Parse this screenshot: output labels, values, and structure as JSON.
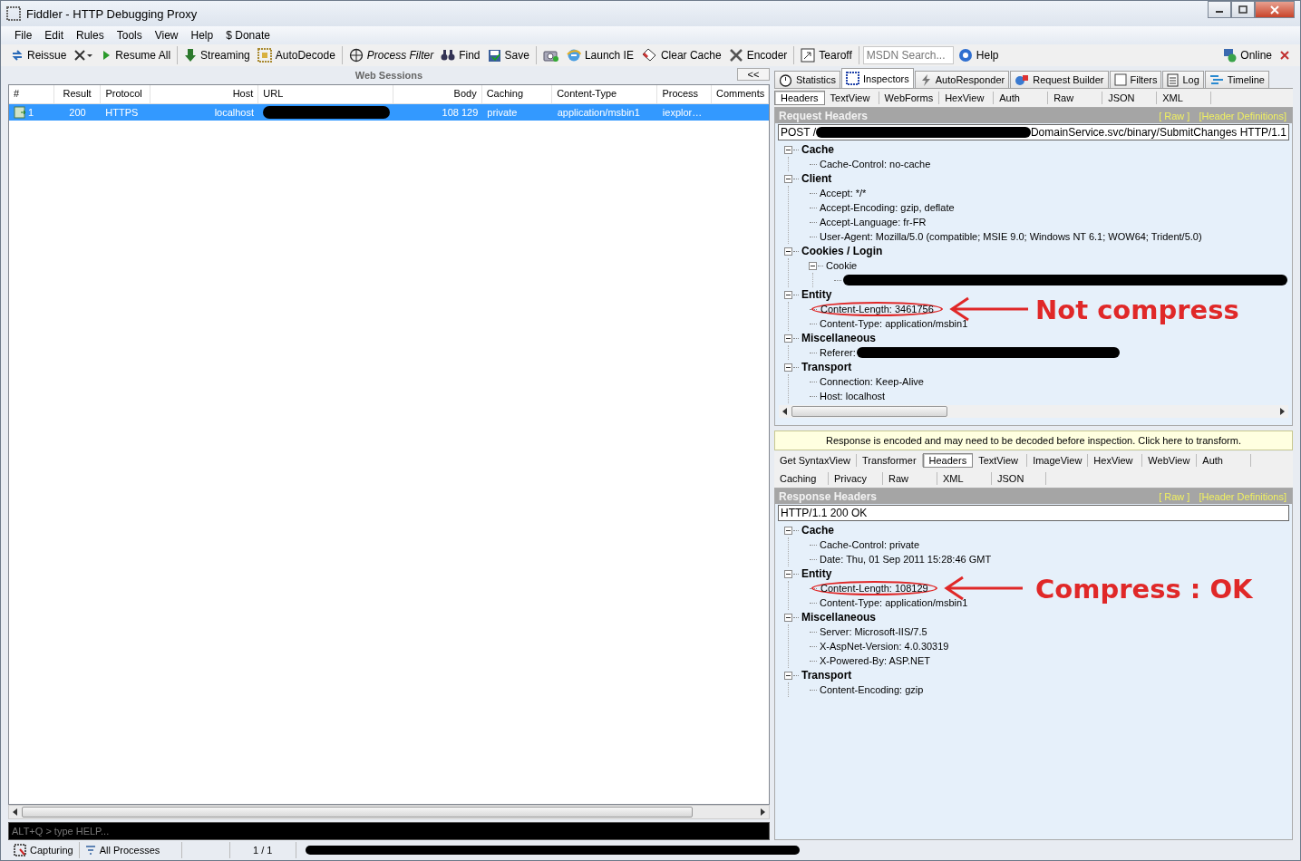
{
  "window": {
    "title": "Fiddler - HTTP Debugging Proxy"
  },
  "menu": [
    "File",
    "Edit",
    "Rules",
    "Tools",
    "View",
    "Help",
    "$ Donate"
  ],
  "toolbar": [
    {
      "kind": "reissue",
      "label": "Reissue"
    },
    {
      "kind": "remove"
    },
    {
      "kind": "resume",
      "label": "Resume All"
    },
    {
      "kind": "stream",
      "label": "Streaming"
    },
    {
      "kind": "decode",
      "label": "AutoDecode"
    },
    {
      "kind": "filter",
      "label": "Process Filter"
    },
    {
      "kind": "find",
      "label": "Find"
    },
    {
      "kind": "save",
      "label": "Save"
    },
    {
      "kind": "snapshot"
    },
    {
      "kind": "browser",
      "label": "Launch IE"
    },
    {
      "kind": "clear",
      "label": "Clear Cache"
    },
    {
      "kind": "encoder",
      "label": "Encoder"
    },
    {
      "kind": "tearoff",
      "label": "Tearoff"
    },
    {
      "kind": "search",
      "placeholder": "MSDN Search..."
    },
    {
      "kind": "help",
      "label": "Help"
    }
  ],
  "online": {
    "label": "Online"
  },
  "sessions": {
    "title": "Web Sessions",
    "collapse": "<<",
    "columns": [
      "#",
      "Result",
      "Protocol",
      "Host",
      "URL",
      "Body",
      "Caching",
      "Content-Type",
      "Process",
      "Comments"
    ],
    "rows": [
      {
        "selected": true,
        "cells": [
          "1",
          "200",
          "HTTPS",
          "localhost",
          "",
          "108 129",
          "private",
          "application/msbin1",
          "iexplor…",
          ""
        ]
      }
    ]
  },
  "command_line": {
    "placeholder": "ALT+Q > type HELP..."
  },
  "status_bar": {
    "capturing": "Capturing",
    "processes": "All Processes",
    "count": "1 / 1"
  },
  "tabs": [
    {
      "kind": "stats",
      "label": "Statistics",
      "selected": false
    },
    {
      "kind": "inspect",
      "label": "Inspectors",
      "selected": true
    },
    {
      "kind": "auto",
      "label": "AutoResponder",
      "selected": false
    },
    {
      "kind": "builder",
      "label": "Request Builder",
      "selected": false
    },
    {
      "kind": "filters",
      "label": "Filters",
      "selected": false
    },
    {
      "kind": "log",
      "label": "Log",
      "selected": false
    },
    {
      "kind": "timeline",
      "label": "Timeline",
      "selected": false
    }
  ],
  "request": {
    "tabs": [
      {
        "label": "Headers",
        "selected": true
      },
      {
        "label": "TextView",
        "selected": false
      },
      {
        "label": "WebForms",
        "selected": false
      },
      {
        "label": "HexView",
        "selected": false
      },
      {
        "label": "Auth",
        "selected": false
      },
      {
        "label": "Raw",
        "selected": false
      },
      {
        "label": "JSON",
        "selected": false
      },
      {
        "label": "XML",
        "selected": false
      }
    ],
    "title": "Request Headers",
    "links": [
      "[ Raw ]",
      "[Header Definitions]"
    ],
    "line_start": "POST /",
    "line_end": "DomainService.svc/binary/SubmitChanges HTTP/1.1",
    "annotation": "Not compress",
    "tree": [
      {
        "label": "Cache",
        "expanded": true,
        "children": [
          {
            "label": "Cache-Control: no-cache"
          }
        ]
      },
      {
        "label": "Client",
        "expanded": true,
        "children": [
          {
            "label": "Accept: */*"
          },
          {
            "label": "Accept-Encoding: gzip, deflate"
          },
          {
            "label": "Accept-Language: fr-FR"
          },
          {
            "label": "User-Agent: Mozilla/5.0 (compatible; MSIE 9.0; Windows NT 6.1; WOW64; Trident/5.0)"
          }
        ]
      },
      {
        "label": "Cookies / Login",
        "expanded": true,
        "children": [
          {
            "label": "Cookie",
            "expanded": true,
            "children": [
              {
                "redacted": true
              }
            ]
          }
        ]
      },
      {
        "label": "Entity",
        "expanded": true,
        "children": [
          {
            "label": "Content-Length: 3461756",
            "circled": true
          },
          {
            "label": "Content-Type: application/msbin1"
          }
        ]
      },
      {
        "label": "Miscellaneous",
        "expanded": true,
        "children": [
          {
            "label": "Referer:",
            "redacted": true
          }
        ]
      },
      {
        "label": "Transport",
        "expanded": true,
        "children": [
          {
            "label": "Connection: Keep-Alive"
          },
          {
            "label": "Host: localhost"
          }
        ]
      }
    ]
  },
  "banner": "Response is encoded and may need to be decoded before inspection. Click here to transform.",
  "response": {
    "tab_rows": [
      [
        {
          "label": "Get SyntaxView",
          "selected": false
        },
        {
          "label": "Transformer",
          "selected": false
        },
        {
          "label": "Headers",
          "selected": true
        },
        {
          "label": "TextView",
          "selected": false
        },
        {
          "label": "ImageView",
          "selected": false
        },
        {
          "label": "HexView",
          "selected": false
        },
        {
          "label": "WebView",
          "selected": false
        },
        {
          "label": "Auth",
          "selected": false
        }
      ],
      [
        {
          "label": "Caching",
          "selected": false
        },
        {
          "label": "Privacy",
          "selected": false
        },
        {
          "label": "Raw",
          "selected": false
        },
        {
          "label": "XML",
          "selected": false
        },
        {
          "label": "JSON",
          "selected": false
        }
      ]
    ],
    "title": "Response Headers",
    "links": [
      "[ Raw ]",
      "[Header Definitions]"
    ],
    "status_line": "HTTP/1.1 200 OK",
    "annotation": "Compress : OK",
    "tree": [
      {
        "label": "Cache",
        "expanded": true,
        "children": [
          {
            "label": "Cache-Control: private"
          },
          {
            "label": "Date: Thu, 01 Sep 2011 15:28:46 GMT"
          }
        ]
      },
      {
        "label": "Entity",
        "expanded": true,
        "children": [
          {
            "label": "Content-Length: 108129",
            "circled": true
          },
          {
            "label": "Content-Type: application/msbin1"
          }
        ]
      },
      {
        "label": "Miscellaneous",
        "expanded": true,
        "children": [
          {
            "label": "Server: Microsoft-IIS/7.5"
          },
          {
            "label": "X-AspNet-Version: 4.0.30319"
          },
          {
            "label": "X-Powered-By: ASP.NET"
          }
        ]
      },
      {
        "label": "Transport",
        "expanded": true,
        "children": [
          {
            "label": "Content-Encoding: gzip"
          }
        ]
      }
    ]
  }
}
